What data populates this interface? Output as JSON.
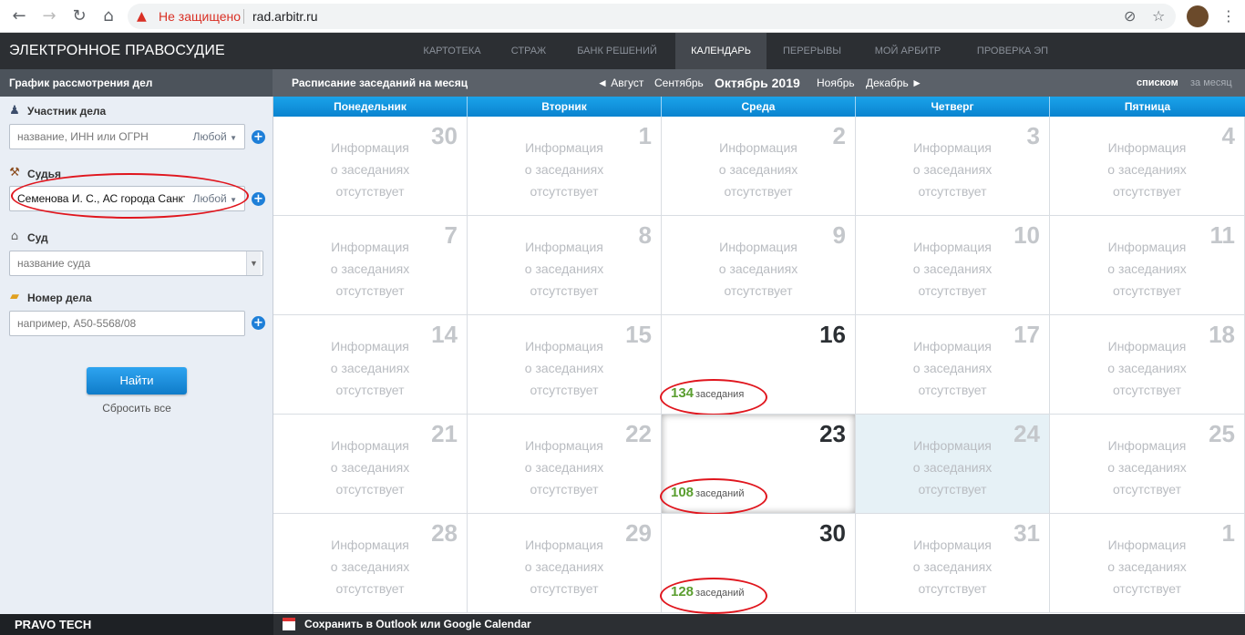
{
  "browser": {
    "warning": "Не защищено",
    "url": "rad.arbitr.ru"
  },
  "nav": {
    "brand": "ЭЛЕКТРОННОЕ ПРАВОСУДИЕ",
    "items": [
      "КАРТОТЕКА",
      "СТРАЖ",
      "БАНК РЕШЕНИЙ",
      "КАЛЕНДАРЬ",
      "ПЕРЕРЫВЫ",
      "МОЙ АРБИТР",
      "ПРОВЕРКА ЭП"
    ],
    "active": "КАЛЕНДАРЬ"
  },
  "subheader": {
    "left_title": "График рассмотрения дел",
    "schedule_title": "Расписание заседаний на месяц",
    "months": {
      "prev2": "◄ Август",
      "prev1": "Сентябрь",
      "current": "Октябрь 2019",
      "next1": "Ноябрь",
      "next2": "Декабрь ►"
    },
    "view_list": "списком",
    "view_month": "за месяц"
  },
  "sidebar": {
    "participant_label": "Участник дела",
    "participant_placeholder": "название, ИНН или ОГРН",
    "any_label": "Любой",
    "judge_label": "Судья",
    "judge_value": "Семенова И. С., АС города Санкт-Петербурга и Ленинградской области",
    "court_label": "Суд",
    "court_placeholder": "название суда",
    "case_label": "Номер дела",
    "case_placeholder": "например, А50-5568/08",
    "find_button": "Найти",
    "reset_link": "Сбросить все"
  },
  "calendar": {
    "days": [
      "Понедельник",
      "Вторник",
      "Среда",
      "Четверг",
      "Пятница"
    ],
    "no_info": [
      "Информация",
      "о заседаниях",
      "отсутствует"
    ],
    "weeks": [
      [
        {
          "d": "30"
        },
        {
          "d": "1"
        },
        {
          "d": "2"
        },
        {
          "d": "3"
        },
        {
          "d": "4"
        }
      ],
      [
        {
          "d": "7"
        },
        {
          "d": "8"
        },
        {
          "d": "9"
        },
        {
          "d": "10"
        },
        {
          "d": "11"
        }
      ],
      [
        {
          "d": "14"
        },
        {
          "d": "15"
        },
        {
          "d": "16",
          "count": "134",
          "unit": "заседания"
        },
        {
          "d": "17"
        },
        {
          "d": "18"
        }
      ],
      [
        {
          "d": "21"
        },
        {
          "d": "22"
        },
        {
          "d": "23",
          "count": "108",
          "unit": "заседаний",
          "selected": true
        },
        {
          "d": "24",
          "today": true
        },
        {
          "d": "25"
        }
      ],
      [
        {
          "d": "28"
        },
        {
          "d": "29"
        },
        {
          "d": "30",
          "count": "128",
          "unit": "заседаний"
        },
        {
          "d": "31"
        },
        {
          "d": "1"
        }
      ]
    ]
  },
  "footer": {
    "brand": "PRAVO TECH",
    "save_calendar": "Сохранить в Outlook или Google Calendar"
  },
  "colors": {
    "accent": "#0f8fdc",
    "count_green": "#5a9e2f",
    "annotation_red": "#e0161e"
  }
}
